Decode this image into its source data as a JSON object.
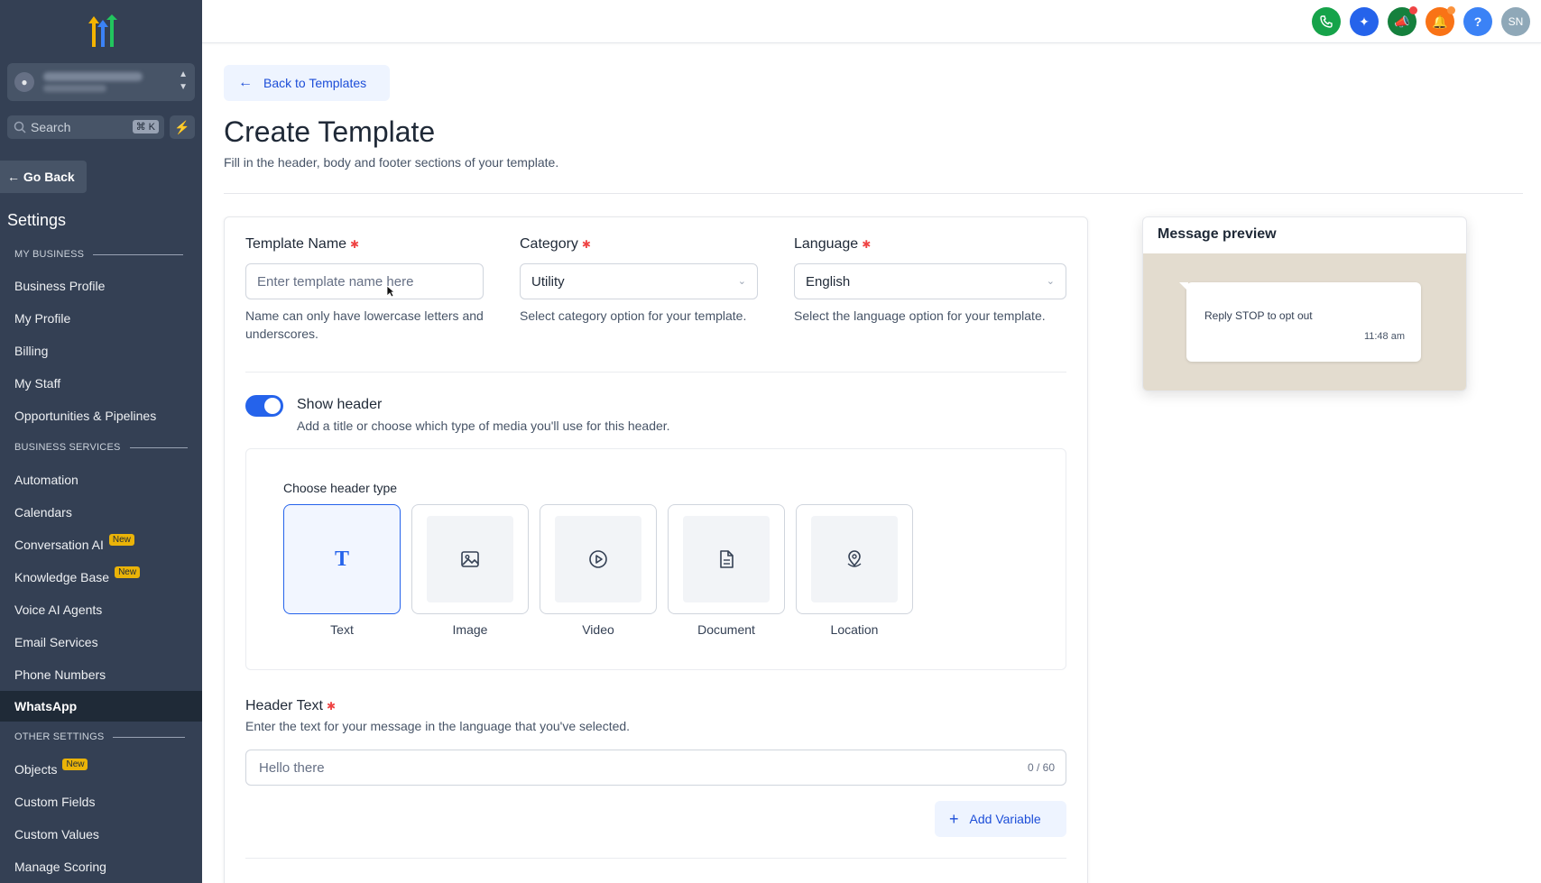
{
  "sidebar": {
    "search_placeholder": "Search",
    "search_shortcut": "⌘ K",
    "go_back": "Go Back",
    "settings_title": "Settings",
    "sections": {
      "my_business": "MY BUSINESS",
      "business_services": "BUSINESS SERVICES",
      "other_settings": "OTHER SETTINGS"
    },
    "items": [
      {
        "label": "Business Profile"
      },
      {
        "label": "My Profile"
      },
      {
        "label": "Billing"
      },
      {
        "label": "My Staff"
      },
      {
        "label": "Opportunities & Pipelines"
      },
      {
        "label": "Automation"
      },
      {
        "label": "Calendars"
      },
      {
        "label": "Conversation AI",
        "badge": "New"
      },
      {
        "label": "Knowledge Base",
        "badge": "New"
      },
      {
        "label": "Voice AI Agents"
      },
      {
        "label": "Email Services"
      },
      {
        "label": "Phone Numbers"
      },
      {
        "label": "WhatsApp",
        "active": true
      },
      {
        "label": "Objects",
        "badge": "New"
      },
      {
        "label": "Custom Fields"
      },
      {
        "label": "Custom Values"
      },
      {
        "label": "Manage Scoring"
      }
    ]
  },
  "topbar": {
    "avatar_initials": "SN",
    "icons": [
      "phone-icon",
      "sparkle-icon",
      "megaphone-icon",
      "bell-icon",
      "help-icon"
    ],
    "colors": {
      "phone": "#16a34a",
      "sparkle": "#2563eb",
      "megaphone": "#15803d",
      "bell": "#f97316",
      "help": "#3b82f6",
      "avatar": "#8fa8b8"
    }
  },
  "main": {
    "back_label": "Back to Templates",
    "title": "Create Template",
    "subtitle": "Fill in the header, body and footer sections of your template.",
    "template_name": {
      "label": "Template Name",
      "placeholder": "Enter template name here",
      "help": "Name can only have lowercase letters and underscores."
    },
    "category": {
      "label": "Category",
      "value": "Utility",
      "help": "Select category option for your template."
    },
    "language": {
      "label": "Language",
      "value": "English",
      "help": "Select the language option for your template."
    },
    "show_header": {
      "label": "Show header",
      "description": "Add a title or choose which type of media you'll use for this header.",
      "enabled": true
    },
    "header_type": {
      "label": "Choose header type",
      "options": [
        {
          "label": "Text",
          "icon": "text-icon",
          "selected": true
        },
        {
          "label": "Image",
          "icon": "image-icon"
        },
        {
          "label": "Video",
          "icon": "video-icon"
        },
        {
          "label": "Document",
          "icon": "document-icon"
        },
        {
          "label": "Location",
          "icon": "location-icon"
        }
      ]
    },
    "header_text": {
      "label": "Header Text",
      "description": "Enter the text for your message in the language that you've selected.",
      "placeholder": "Hello there",
      "counter": "0 / 60"
    },
    "add_variable": "Add Variable"
  },
  "preview": {
    "title": "Message preview",
    "message": "Reply STOP to opt out",
    "time": "11:48 am"
  }
}
